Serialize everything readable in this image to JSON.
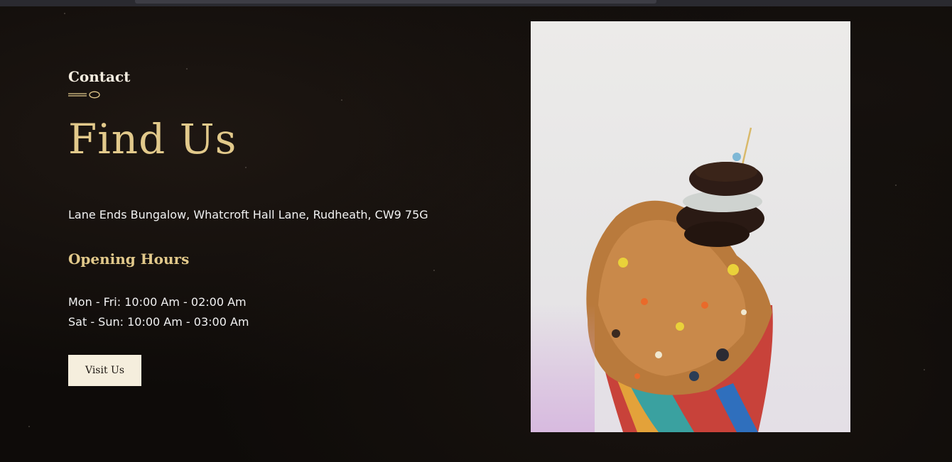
{
  "contact": {
    "section_label": "Contact",
    "heading": "Find Us",
    "address": "Lane Ends Bungalow, Whatcroft Hall Lane, Rudheath, CW9 75G"
  },
  "opening_hours": {
    "title": "Opening Hours",
    "lines": [
      "Mon - Fri: 10:00 Am - 02:00 Am",
      "Sat - Sun: 10:00 Am - 03:00 Am"
    ]
  },
  "cta": {
    "visit_label": "Visit Us"
  },
  "icons": {
    "divider": "spoon-icon"
  },
  "colors": {
    "background": "#0e0b09",
    "accent_gold": "#e2c98b",
    "text_light": "#f2f2f2",
    "button_bg": "#f5eedd"
  }
}
